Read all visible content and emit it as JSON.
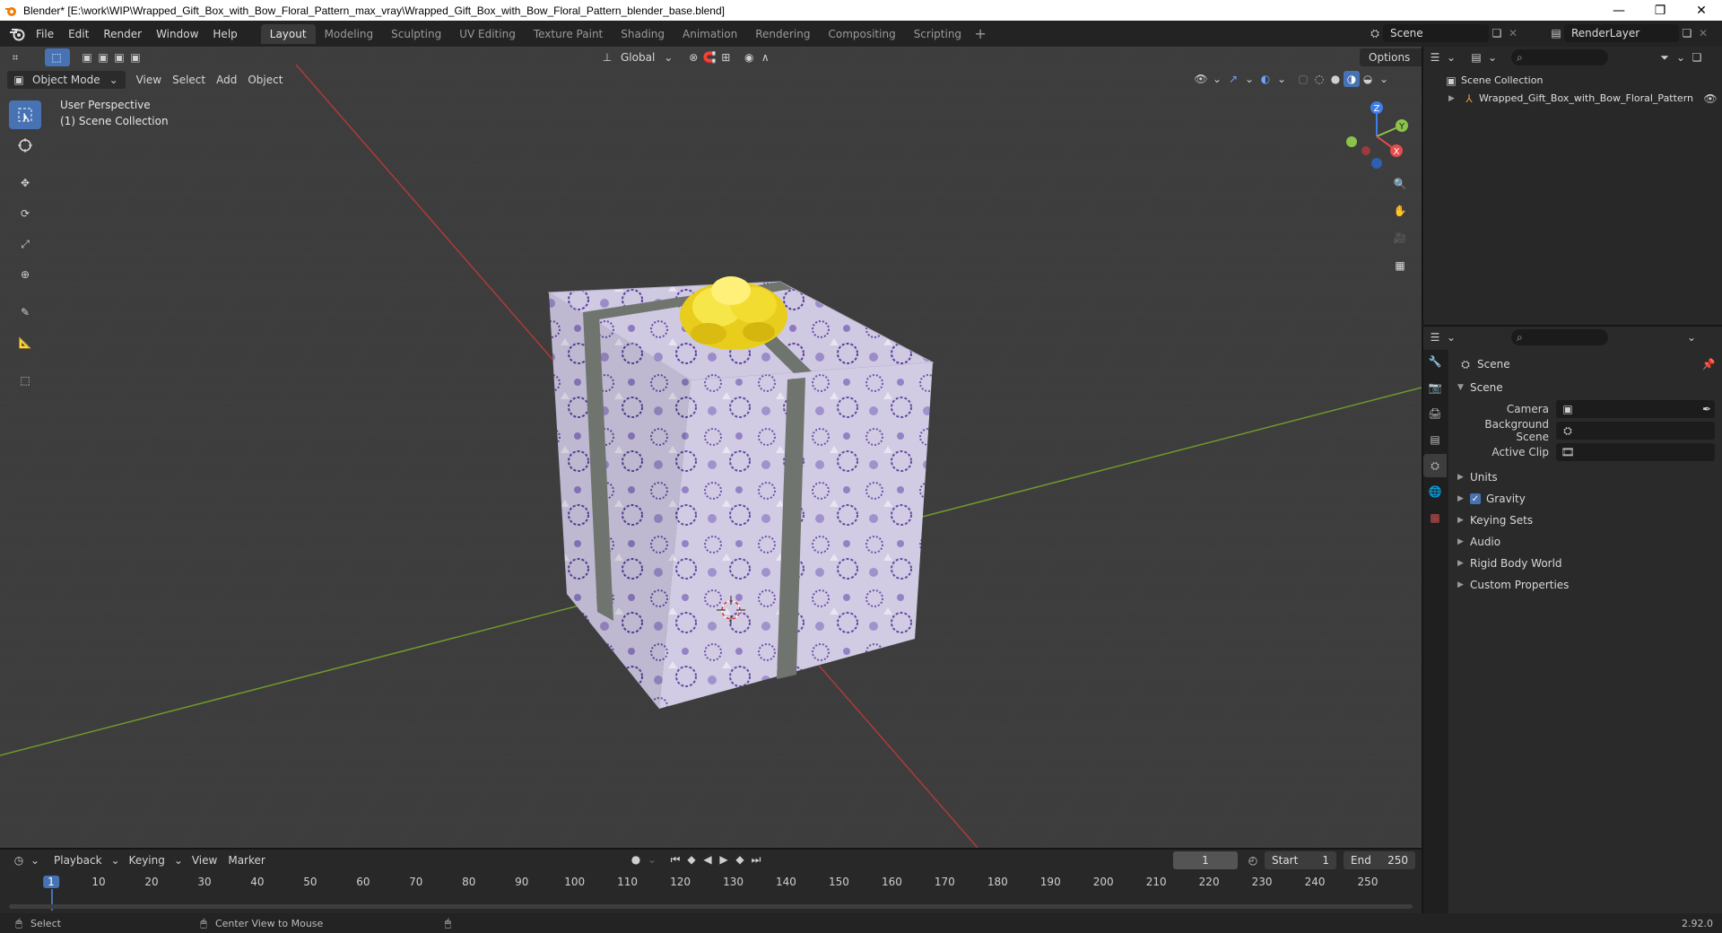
{
  "window": {
    "title": "Blender* [E:\\work\\WIP\\Wrapped_Gift_Box_with_Bow_Floral_Pattern_max_vray\\Wrapped_Gift_Box_with_Bow_Floral_Pattern_blender_base.blend]"
  },
  "menu": [
    "File",
    "Edit",
    "Render",
    "Window",
    "Help"
  ],
  "workspaces": [
    "Layout",
    "Modeling",
    "Sculpting",
    "UV Editing",
    "Texture Paint",
    "Shading",
    "Animation",
    "Rendering",
    "Compositing",
    "Scripting"
  ],
  "active_workspace": "Layout",
  "scene_name": "Scene",
  "view_layer": "RenderLayer",
  "viewport": {
    "orientation": "Global",
    "options_label": "Options",
    "mode": "Object Mode",
    "menus": [
      "View",
      "Select",
      "Add",
      "Object"
    ],
    "perspective_label": "User Perspective",
    "collection_label": "(1) Scene Collection",
    "gizmo_axes": [
      "Z",
      "Y",
      "X"
    ]
  },
  "outliner": {
    "root": "Scene Collection",
    "item": "Wrapped_Gift_Box_with_Bow_Floral_Pattern"
  },
  "properties": {
    "context": "Scene",
    "panel_title": "Scene",
    "fields": [
      {
        "label": "Camera",
        "value": ""
      },
      {
        "label": "Background Scene",
        "value": ""
      },
      {
        "label": "Active Clip",
        "value": ""
      }
    ],
    "panels": [
      "Units",
      "Gravity",
      "Keying Sets",
      "Audio",
      "Rigid Body World",
      "Custom Properties"
    ],
    "gravity_checked": true
  },
  "timeline": {
    "menus": [
      "Playback",
      "Keying",
      "View",
      "Marker"
    ],
    "current_frame": "1",
    "start_label": "Start",
    "start": "1",
    "end_label": "End",
    "end": "250",
    "ruler": [
      "1",
      "10",
      "20",
      "30",
      "40",
      "50",
      "60",
      "70",
      "80",
      "90",
      "100",
      "110",
      "120",
      "130",
      "140",
      "150",
      "160",
      "170",
      "180",
      "190",
      "200",
      "210",
      "220",
      "230",
      "240",
      "250"
    ]
  },
  "statusbar": {
    "select": "Select",
    "center": "Center View to Mouse",
    "version": "2.92.0"
  },
  "colors": {
    "accent": "#4772b3",
    "x_axis": "#e84c4c",
    "y_axis": "#8bc34a",
    "z_axis": "#3f7ee8",
    "giftbox": "#c9c3dc",
    "bow": "#f2dd2a"
  }
}
